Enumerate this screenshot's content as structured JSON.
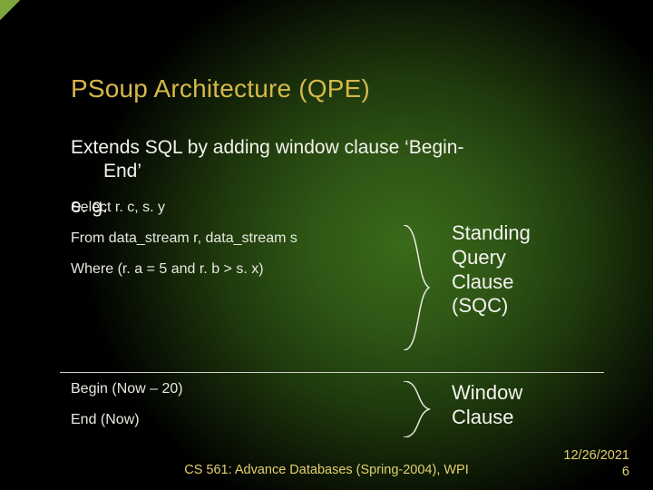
{
  "title": "PSoup Architecture (QPE)",
  "intro_line1": "Extends SQL by adding window clause ‘Begin-",
  "intro_line2": "End’",
  "eg": "e. g.",
  "query": {
    "select": "Select r. c, s. y",
    "from": "From data_stream r, data_stream s",
    "where": "Where (r. a = 5 and r. b > s. x)",
    "begin": "Begin (Now – 20)",
    "end": "End (Now)"
  },
  "labels": {
    "sqc_l1": "Standing",
    "sqc_l2": "Query",
    "sqc_l3": "Clause",
    "sqc_l4": "(SQC)",
    "wc_l1": "Window",
    "wc_l2": "Clause"
  },
  "footer": "CS 561: Advance Databases (Spring-2004), WPI",
  "date": "12/26/2021",
  "page": "6"
}
